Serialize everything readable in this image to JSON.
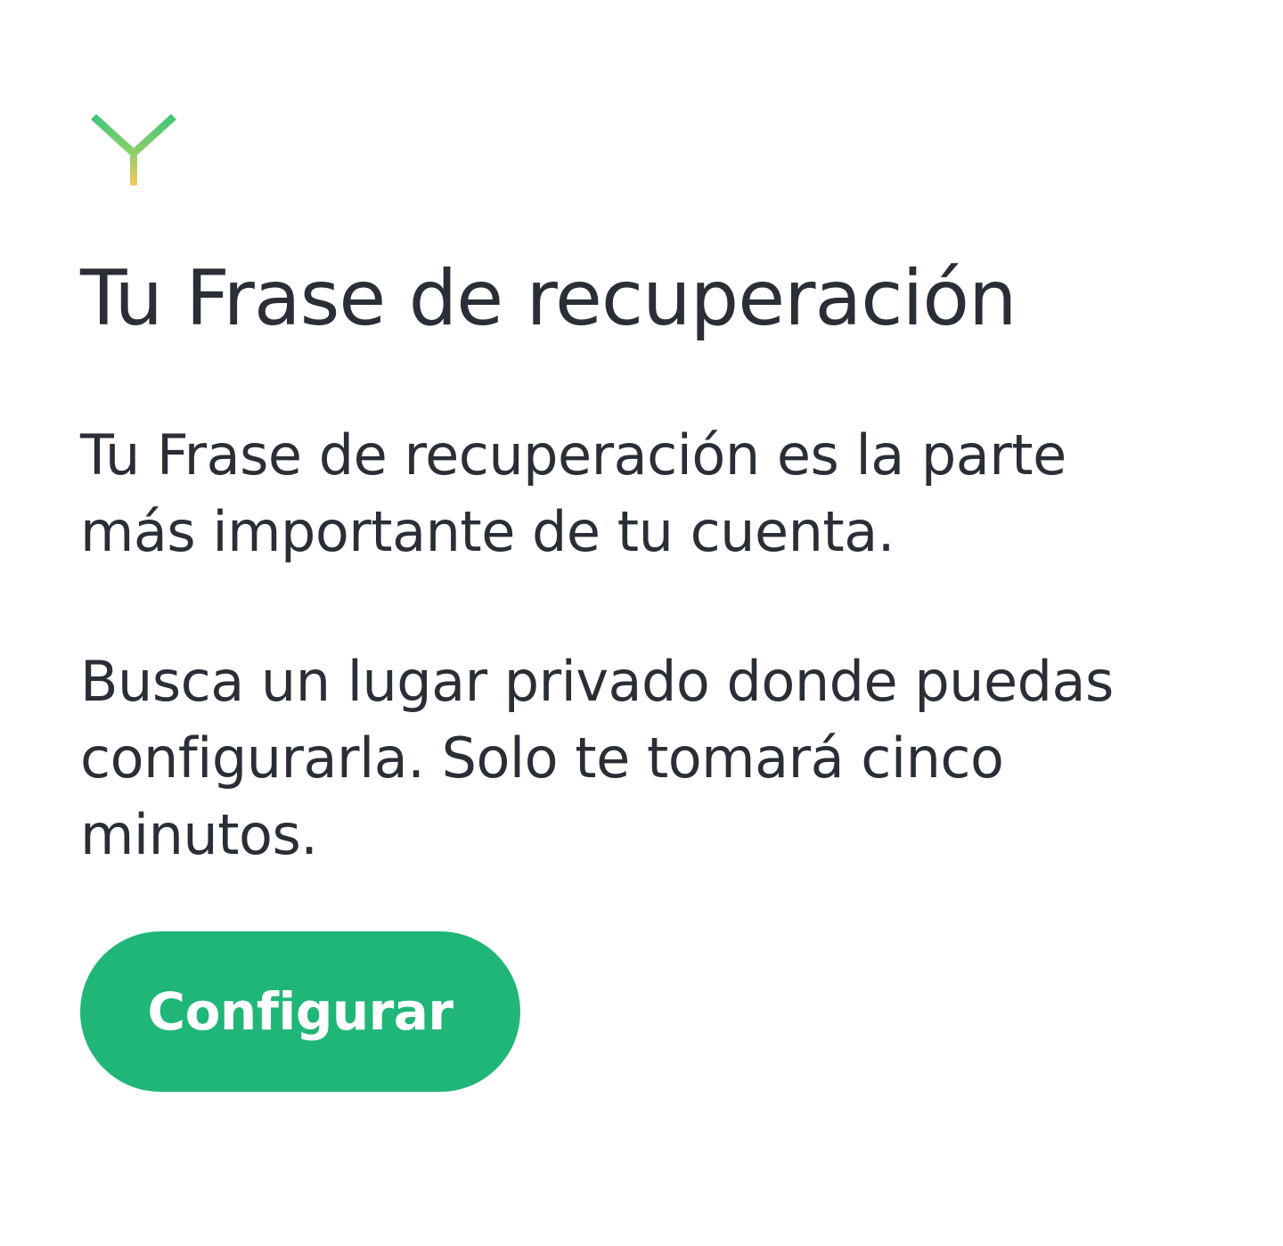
{
  "logo": {
    "icon": "v-logo-icon",
    "gradient_top": "#3cc47c",
    "gradient_bottom": "#f6c95a"
  },
  "title": "Tu Frase de recuperación",
  "paragraphs": [
    "Tu Frase de recuperación es la parte más importante de tu cuenta.",
    "Busca un lugar privado donde puedas configurarla. Solo te tomará cinco minutos."
  ],
  "button": {
    "label": "Configurar",
    "color": "#1fb677",
    "text_color": "#ffffff"
  },
  "colors": {
    "text": "#2a2e36",
    "background": "#ffffff"
  }
}
